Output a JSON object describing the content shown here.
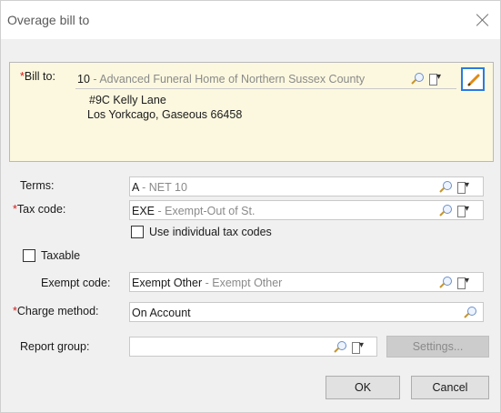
{
  "window": {
    "title": "Overage bill to"
  },
  "bill_to": {
    "label": "Bill to:",
    "code": "10",
    "sep": " - ",
    "name": "Advanced Funeral Home of Northern Sussex County",
    "address_line1": "#9C Kelly Lane",
    "address_line2": "Los Yorkcago, Gaseous 66458"
  },
  "terms": {
    "label": "Terms:",
    "code": "A",
    "sep": " - ",
    "desc": "NET 10"
  },
  "tax_code": {
    "label": "Tax code:",
    "code": "EXE",
    "sep": " - ",
    "desc": "Exempt-Out of St."
  },
  "use_individual": {
    "label": "Use individual tax codes",
    "checked": false
  },
  "taxable": {
    "label": "Taxable",
    "checked": false
  },
  "exempt_code": {
    "label": "Exempt code:",
    "code": "Exempt Other",
    "sep": " - ",
    "desc": "Exempt Other"
  },
  "charge_method": {
    "label": "Charge method:",
    "value": "On Account"
  },
  "report_group": {
    "label": "Report group:",
    "value": "",
    "settings_label": "Settings..."
  },
  "buttons": {
    "ok": "OK",
    "cancel": "Cancel"
  },
  "required_marker": "*",
  "colors": {
    "required": "#d11a1a",
    "bill_bg": "#fcf8df",
    "accent": "#2a7be0",
    "desc_text": "#8a8a8a"
  }
}
